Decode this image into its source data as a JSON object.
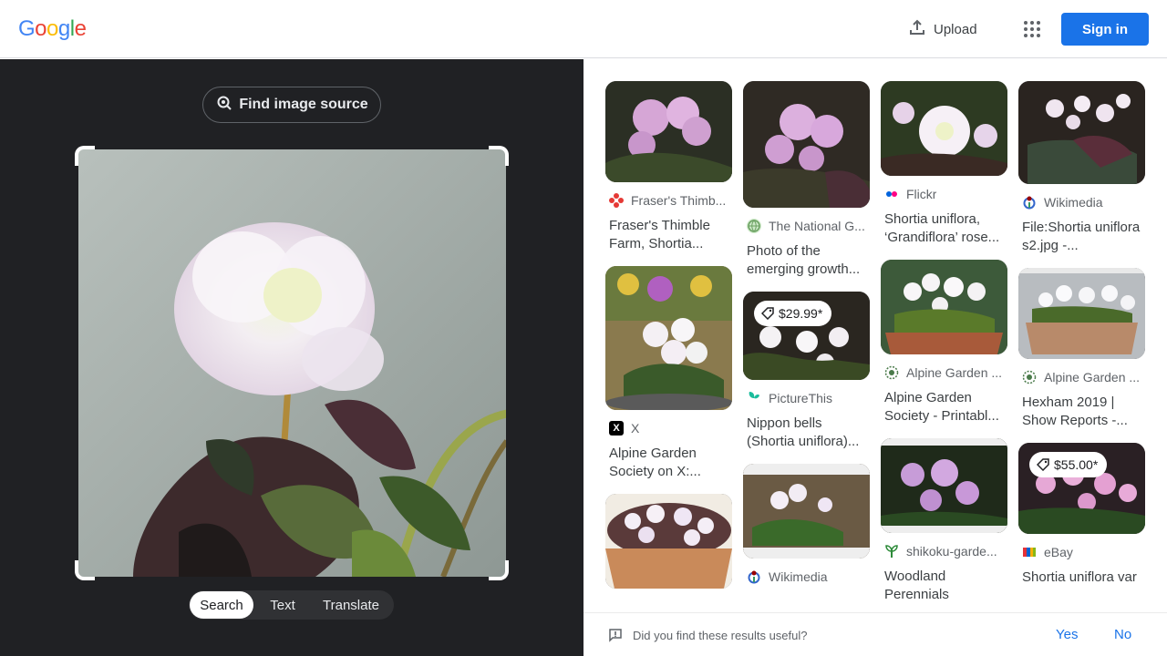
{
  "header": {
    "logo_letters": [
      "G",
      "o",
      "o",
      "g",
      "l",
      "e"
    ],
    "logo_colors": [
      "#4285f4",
      "#ea4335",
      "#fbbc05",
      "#4285f4",
      "#34a853",
      "#ea4335"
    ],
    "upload_label": "Upload",
    "signin_label": "Sign in"
  },
  "lens": {
    "find_source_label": "Find image source",
    "modes": [
      "Search",
      "Text",
      "Translate"
    ],
    "active_mode": "Search"
  },
  "results": {
    "col1": [
      {
        "source": "Fraser's Thimb...",
        "title": "Fraser's Thimble Farm, Shortia...",
        "favicon": "red-flower"
      },
      {
        "source": "X",
        "title": "Alpine Garden Society on X:...",
        "favicon": "x-logo"
      },
      {
        "source": "",
        "title": "",
        "favicon": ""
      }
    ],
    "col2": [
      {
        "source": "The National G...",
        "title": "Photo of the emerging growth...",
        "favicon": "globe"
      },
      {
        "source": "PictureThis",
        "title": "Nippon bells (Shortia uniflora)...",
        "favicon": "leaf",
        "price": "$29.99*"
      },
      {
        "source": "Wikimedia",
        "title": "",
        "favicon": "wikimedia"
      }
    ],
    "col3": [
      {
        "source": "Flickr",
        "title": "Shortia uniflora, ‘Grandiflora’ rose...",
        "favicon": "flickr"
      },
      {
        "source": "Alpine Garden ...",
        "title": "Alpine Garden Society - Printabl...",
        "favicon": "flower-badge"
      },
      {
        "source": "shikoku-garde...",
        "title": "Woodland Perennials",
        "favicon": "sprout"
      }
    ],
    "col4": [
      {
        "source": "Wikimedia",
        "title": "File:Shortia uniflora s2.jpg -...",
        "favicon": "wikimedia"
      },
      {
        "source": "Alpine Garden ...",
        "title": "Hexham 2019 | Show Reports -...",
        "favicon": "flower-badge"
      },
      {
        "source": "eBay",
        "title": "Shortia uniflora var",
        "favicon": "ebay",
        "price": "$55.00*"
      }
    ]
  },
  "feedback": {
    "question": "Did you find these results useful?",
    "yes": "Yes",
    "no": "No"
  }
}
